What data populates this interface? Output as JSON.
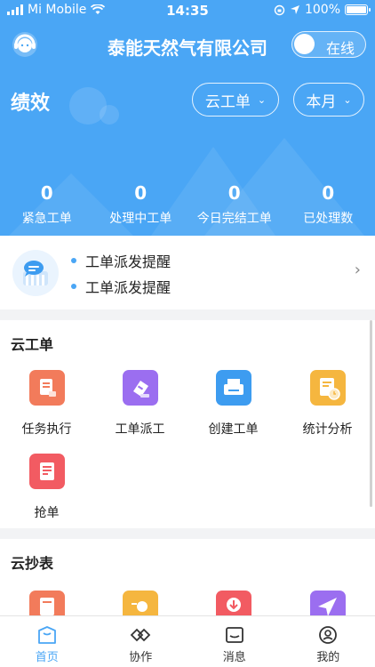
{
  "status_bar": {
    "carrier": "Mi Mobile",
    "time": "14:35",
    "battery": "100%"
  },
  "header": {
    "title": "泰能天然气有限公司",
    "online_toggle_label": "在线"
  },
  "performance": {
    "title": "绩效",
    "filter_type": "云工单",
    "filter_period": "本月",
    "stats": [
      {
        "value": "0",
        "label": "紧急工单"
      },
      {
        "value": "0",
        "label": "处理中工单"
      },
      {
        "value": "0",
        "label": "今日完结工单"
      },
      {
        "value": "0",
        "label": "已处理数"
      }
    ]
  },
  "notices": [
    "工单派发提醒",
    "工单派发提醒"
  ],
  "cloud_work_order": {
    "title": "云工单",
    "items": [
      {
        "label": "任务执行",
        "icon": "task-execute-icon",
        "color": "#f27b5b"
      },
      {
        "label": "工单派工",
        "icon": "dispatch-icon",
        "color": "#9b6ef0"
      },
      {
        "label": "创建工单",
        "icon": "create-order-icon",
        "color": "#3d9cf0"
      },
      {
        "label": "统计分析",
        "icon": "statistics-icon",
        "color": "#f5b63f"
      },
      {
        "label": "抢单",
        "icon": "grab-order-icon",
        "color": "#f25b62"
      }
    ]
  },
  "cloud_meter": {
    "title": "云抄表",
    "items": [
      {
        "icon": "meter-reading-icon",
        "color": "#f27b5b"
      },
      {
        "icon": "meter-gauge-icon",
        "color": "#f5b63f"
      },
      {
        "icon": "meter-download-icon",
        "color": "#f25b62"
      },
      {
        "icon": "meter-send-icon",
        "color": "#9b6ef0"
      }
    ]
  },
  "tabs": [
    {
      "label": "首页",
      "icon": "home-icon"
    },
    {
      "label": "协作",
      "icon": "collaboration-icon"
    },
    {
      "label": "消息",
      "icon": "message-icon"
    },
    {
      "label": "我的",
      "icon": "profile-icon"
    }
  ],
  "colors": {
    "primary": "#4aa6f5"
  }
}
